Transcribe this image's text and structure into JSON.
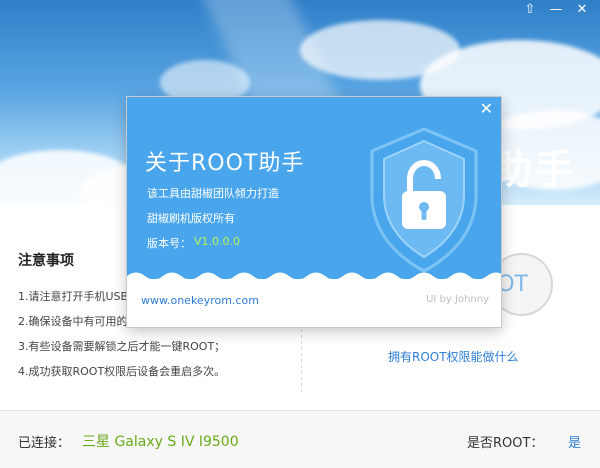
{
  "window": {
    "controls": [
      "⇧",
      "—",
      "✕"
    ]
  },
  "background": {
    "title_partial": "助手"
  },
  "notes": {
    "title": "注意事项",
    "items": [
      "1.请注意打开手机USB",
      "2.确保设备中有可用的",
      "3.有些设备需要解锁之后才能一键ROOT；",
      "4.成功获取ROOT权限后设备会重启多次。"
    ]
  },
  "root_button": {
    "label": "OT"
  },
  "links": {
    "what_root": "拥有ROOT权限能做什么"
  },
  "footer": {
    "connected_label": "已连接：",
    "device": "三星 Galaxy S IV I9500",
    "is_root_label": "是否ROOT：",
    "is_root_value": "是"
  },
  "about_dialog": {
    "close_glyph": "✕",
    "title": "关于ROOT助手",
    "line1": "该工具由甜椒团队倾力打造",
    "line2": "甜椒刷机版权所有",
    "version_label": "版本号：",
    "version_value": "V1.0.0.0",
    "website": "www.onekeyrom.com",
    "credit": "UI by Johnny"
  },
  "colors": {
    "dialog_blue": "#4aa6ec",
    "version_green": "#b6f25a",
    "device_green": "#6aaa1a",
    "link_blue": "#2f7ed6"
  }
}
